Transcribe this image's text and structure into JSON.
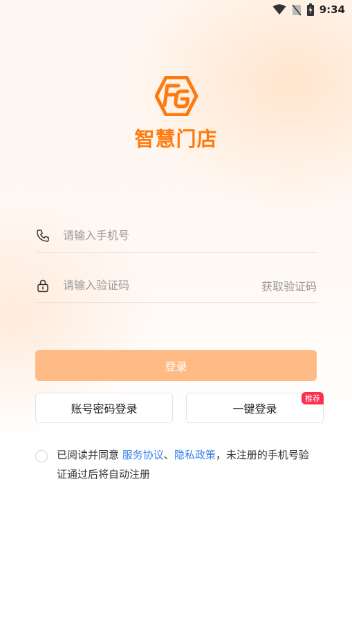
{
  "status_bar": {
    "time": "9:34"
  },
  "app": {
    "name": "智慧门店",
    "logo_text": "FG"
  },
  "phone_field": {
    "placeholder": "请输入手机号"
  },
  "code_field": {
    "placeholder": "请输入验证码",
    "get_code_label": "获取验证码"
  },
  "login_button": {
    "label": "登录"
  },
  "password_login": {
    "label": "账号密码登录"
  },
  "one_click_login": {
    "label": "一键登录",
    "badge": "推荐"
  },
  "agreement": {
    "prefix": "已阅读并同意 ",
    "service_link": "服务协议",
    "separator": "、",
    "privacy_link": "隐私政策",
    "suffix": "，未注册的手机号验证通过后将自动注册"
  },
  "colors": {
    "brand": "#ff7a0e",
    "button": "#ffbb86",
    "link": "#3b82e8",
    "badge": "#ff2d4f"
  }
}
